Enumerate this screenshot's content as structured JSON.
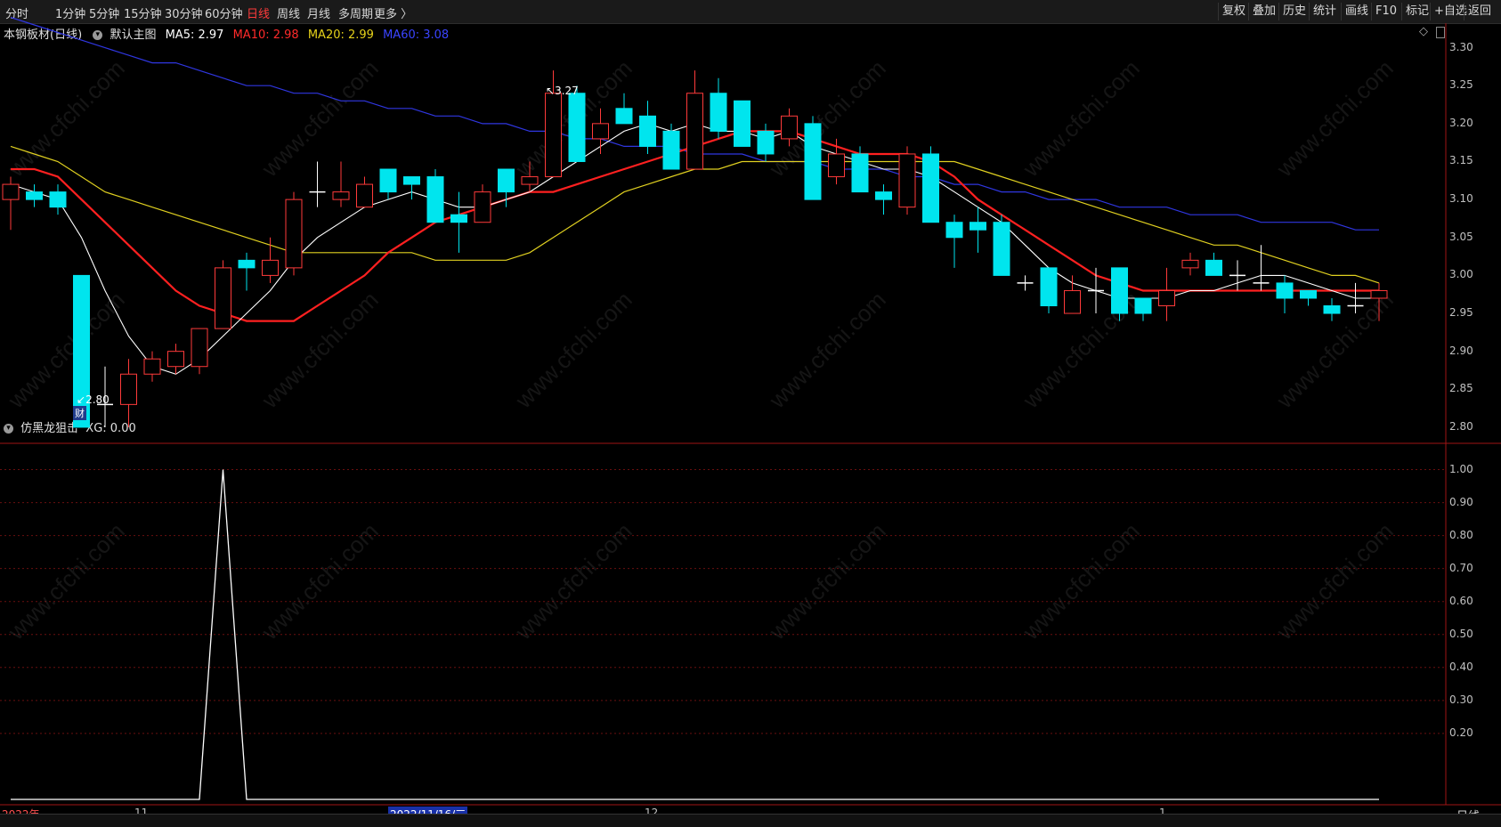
{
  "toolbar": {
    "periods": [
      "分时",
      "1分钟",
      "5分钟",
      "15分钟",
      "30分钟",
      "60分钟",
      "日线",
      "周线",
      "月线",
      "多周期",
      "更多 〉"
    ],
    "active_period": "日线",
    "right_buttons": [
      "复权",
      "叠加",
      "历史",
      "统计",
      "画线",
      "F10",
      "标记",
      "+自选",
      "返回"
    ]
  },
  "main": {
    "stock_name": "本钢板材(日线)",
    "chart_label": "默认主图",
    "ma5": "MA5: 2.97",
    "ma10": "MA10: 2.98",
    "ma20": "MA20: 2.99",
    "ma60": "MA60: 3.08",
    "high_label": "3.27",
    "low_label": "2.80",
    "cai_badge": "财",
    "y_ticks": [
      "3.30",
      "3.25",
      "3.20",
      "3.15",
      "3.10",
      "3.05",
      "3.00",
      "2.95",
      "2.90",
      "2.85",
      "2.80"
    ]
  },
  "sub": {
    "indicator_name": "仿黑龙狙击",
    "xg_value": "XG: 0.00",
    "y_ticks": [
      "1.00",
      "0.90",
      "0.80",
      "0.70",
      "0.60",
      "0.50",
      "0.40",
      "0.30",
      "0.20"
    ]
  },
  "xaxis": {
    "labels": [
      "2022年",
      "11",
      "12",
      "1"
    ],
    "cursor_date": "2022/11/16/三"
  },
  "side": {
    "daily_label": "日线"
  },
  "watermark": "www.cfchi.com",
  "colors": {
    "up": "#ff3a3a",
    "down": "#00e5ee",
    "ma5": "#ffffff",
    "ma10": "#ff2020",
    "ma20": "#e0d020",
    "ma60": "#2f36e0",
    "grid": "#6a0f0f"
  },
  "chart_data": [
    {
      "type": "candlestick",
      "ylim": [
        2.78,
        3.33
      ],
      "candles": [
        {
          "o": 3.1,
          "c": 3.12,
          "h": 3.13,
          "l": 3.06
        },
        {
          "o": 3.11,
          "c": 3.1,
          "h": 3.12,
          "l": 3.09
        },
        {
          "o": 3.11,
          "c": 3.09,
          "h": 3.12,
          "l": 3.08
        },
        {
          "o": 3.0,
          "c": 2.8,
          "h": 3.0,
          "l": 2.8
        },
        {
          "o": 2.83,
          "c": 2.83,
          "h": 2.88,
          "l": 2.8
        },
        {
          "o": 2.83,
          "c": 2.87,
          "h": 2.89,
          "l": 2.8
        },
        {
          "o": 2.87,
          "c": 2.89,
          "h": 2.9,
          "l": 2.86
        },
        {
          "o": 2.88,
          "c": 2.9,
          "h": 2.91,
          "l": 2.87
        },
        {
          "o": 2.88,
          "c": 2.93,
          "h": 2.93,
          "l": 2.87
        },
        {
          "o": 2.93,
          "c": 3.01,
          "h": 3.02,
          "l": 2.93
        },
        {
          "o": 3.02,
          "c": 3.01,
          "h": 3.03,
          "l": 2.98
        },
        {
          "o": 3.0,
          "c": 3.02,
          "h": 3.05,
          "l": 2.99
        },
        {
          "o": 3.01,
          "c": 3.1,
          "h": 3.11,
          "l": 3.0
        },
        {
          "o": 3.11,
          "c": 3.11,
          "h": 3.15,
          "l": 3.09
        },
        {
          "o": 3.1,
          "c": 3.11,
          "h": 3.15,
          "l": 3.09
        },
        {
          "o": 3.09,
          "c": 3.12,
          "h": 3.13,
          "l": 3.09
        },
        {
          "o": 3.14,
          "c": 3.11,
          "h": 3.14,
          "l": 3.1
        },
        {
          "o": 3.13,
          "c": 3.12,
          "h": 3.13,
          "l": 3.1
        },
        {
          "o": 3.13,
          "c": 3.07,
          "h": 3.14,
          "l": 3.07
        },
        {
          "o": 3.08,
          "c": 3.07,
          "h": 3.11,
          "l": 3.03
        },
        {
          "o": 3.07,
          "c": 3.11,
          "h": 3.12,
          "l": 3.07
        },
        {
          "o": 3.14,
          "c": 3.11,
          "h": 3.14,
          "l": 3.09
        },
        {
          "o": 3.12,
          "c": 3.13,
          "h": 3.15,
          "l": 3.11
        },
        {
          "o": 3.13,
          "c": 3.24,
          "h": 3.27,
          "l": 3.13
        },
        {
          "o": 3.24,
          "c": 3.15,
          "h": 3.25,
          "l": 3.15
        },
        {
          "o": 3.18,
          "c": 3.2,
          "h": 3.22,
          "l": 3.16
        },
        {
          "o": 3.22,
          "c": 3.2,
          "h": 3.24,
          "l": 3.2
        },
        {
          "o": 3.21,
          "c": 3.17,
          "h": 3.23,
          "l": 3.16
        },
        {
          "o": 3.19,
          "c": 3.14,
          "h": 3.2,
          "l": 3.14
        },
        {
          "o": 3.14,
          "c": 3.24,
          "h": 3.27,
          "l": 3.14
        },
        {
          "o": 3.24,
          "c": 3.19,
          "h": 3.26,
          "l": 3.18
        },
        {
          "o": 3.23,
          "c": 3.17,
          "h": 3.23,
          "l": 3.17
        },
        {
          "o": 3.19,
          "c": 3.16,
          "h": 3.2,
          "l": 3.15
        },
        {
          "o": 3.18,
          "c": 3.21,
          "h": 3.22,
          "l": 3.17
        },
        {
          "o": 3.2,
          "c": 3.1,
          "h": 3.21,
          "l": 3.1
        },
        {
          "o": 3.13,
          "c": 3.16,
          "h": 3.18,
          "l": 3.12
        },
        {
          "o": 3.16,
          "c": 3.11,
          "h": 3.17,
          "l": 3.11
        },
        {
          "o": 3.11,
          "c": 3.1,
          "h": 3.12,
          "l": 3.08
        },
        {
          "o": 3.09,
          "c": 3.16,
          "h": 3.17,
          "l": 3.08
        },
        {
          "o": 3.16,
          "c": 3.07,
          "h": 3.17,
          "l": 3.07
        },
        {
          "o": 3.07,
          "c": 3.05,
          "h": 3.08,
          "l": 3.01
        },
        {
          "o": 3.07,
          "c": 3.06,
          "h": 3.09,
          "l": 3.03
        },
        {
          "o": 3.07,
          "c": 3.0,
          "h": 3.08,
          "l": 3.0
        },
        {
          "o": 2.99,
          "c": 2.99,
          "h": 3.0,
          "l": 2.98
        },
        {
          "o": 3.01,
          "c": 2.96,
          "h": 3.01,
          "l": 2.95
        },
        {
          "o": 2.95,
          "c": 2.98,
          "h": 3.0,
          "l": 2.95
        },
        {
          "o": 2.98,
          "c": 2.98,
          "h": 3.01,
          "l": 2.95
        },
        {
          "o": 3.01,
          "c": 2.95,
          "h": 3.01,
          "l": 2.94
        },
        {
          "o": 2.97,
          "c": 2.95,
          "h": 2.97,
          "l": 2.94
        },
        {
          "o": 2.96,
          "c": 2.98,
          "h": 3.01,
          "l": 2.94
        },
        {
          "o": 3.01,
          "c": 3.02,
          "h": 3.03,
          "l": 3.0
        },
        {
          "o": 3.02,
          "c": 3.0,
          "h": 3.03,
          "l": 3.0
        },
        {
          "o": 3.0,
          "c": 3.0,
          "h": 3.02,
          "l": 2.98
        },
        {
          "o": 2.99,
          "c": 2.99,
          "h": 3.04,
          "l": 2.98
        },
        {
          "o": 2.99,
          "c": 2.97,
          "h": 3.0,
          "l": 2.95
        },
        {
          "o": 2.98,
          "c": 2.97,
          "h": 2.98,
          "l": 2.96
        },
        {
          "o": 2.96,
          "c": 2.95,
          "h": 2.97,
          "l": 2.94
        },
        {
          "o": 2.96,
          "c": 2.96,
          "h": 2.99,
          "l": 2.95
        },
        {
          "o": 2.97,
          "c": 2.98,
          "h": 2.99,
          "l": 2.94
        }
      ],
      "ma5": [
        3.12,
        3.11,
        3.1,
        3.05,
        2.98,
        2.92,
        2.88,
        2.87,
        2.89,
        2.92,
        2.95,
        2.98,
        3.02,
        3.05,
        3.07,
        3.09,
        3.1,
        3.11,
        3.1,
        3.09,
        3.09,
        3.1,
        3.11,
        3.13,
        3.15,
        3.17,
        3.19,
        3.2,
        3.19,
        3.2,
        3.19,
        3.19,
        3.18,
        3.19,
        3.17,
        3.16,
        3.15,
        3.14,
        3.14,
        3.13,
        3.11,
        3.09,
        3.07,
        3.04,
        3.01,
        2.99,
        2.98,
        2.97,
        2.97,
        2.97,
        2.98,
        2.98,
        2.99,
        3.0,
        3.0,
        2.99,
        2.98,
        2.97,
        2.97
      ],
      "ma10": [
        3.14,
        3.14,
        3.13,
        3.1,
        3.07,
        3.04,
        3.01,
        2.98,
        2.96,
        2.95,
        2.94,
        2.94,
        2.94,
        2.96,
        2.98,
        3.0,
        3.03,
        3.05,
        3.07,
        3.08,
        3.09,
        3.1,
        3.11,
        3.11,
        3.12,
        3.13,
        3.14,
        3.15,
        3.16,
        3.17,
        3.18,
        3.19,
        3.19,
        3.19,
        3.18,
        3.17,
        3.16,
        3.16,
        3.16,
        3.15,
        3.13,
        3.1,
        3.08,
        3.06,
        3.04,
        3.02,
        3.0,
        2.99,
        2.98,
        2.98,
        2.98,
        2.98,
        2.98,
        2.98,
        2.98,
        2.98,
        2.98,
        2.98,
        2.98
      ],
      "ma20": [
        3.17,
        3.16,
        3.15,
        3.13,
        3.11,
        3.1,
        3.09,
        3.08,
        3.07,
        3.06,
        3.05,
        3.04,
        3.03,
        3.03,
        3.03,
        3.03,
        3.03,
        3.03,
        3.02,
        3.02,
        3.02,
        3.02,
        3.03,
        3.05,
        3.07,
        3.09,
        3.11,
        3.12,
        3.13,
        3.14,
        3.14,
        3.15,
        3.15,
        3.15,
        3.15,
        3.15,
        3.15,
        3.15,
        3.15,
        3.15,
        3.15,
        3.14,
        3.13,
        3.12,
        3.11,
        3.1,
        3.09,
        3.08,
        3.07,
        3.06,
        3.05,
        3.04,
        3.04,
        3.03,
        3.02,
        3.01,
        3.0,
        3.0,
        2.99
      ],
      "ma60": [
        3.34,
        3.33,
        3.32,
        3.31,
        3.3,
        3.29,
        3.28,
        3.28,
        3.27,
        3.26,
        3.25,
        3.25,
        3.24,
        3.24,
        3.23,
        3.23,
        3.22,
        3.22,
        3.21,
        3.21,
        3.2,
        3.2,
        3.19,
        3.19,
        3.18,
        3.18,
        3.17,
        3.17,
        3.17,
        3.16,
        3.16,
        3.16,
        3.15,
        3.15,
        3.15,
        3.14,
        3.14,
        3.14,
        3.13,
        3.13,
        3.12,
        3.12,
        3.11,
        3.11,
        3.1,
        3.1,
        3.1,
        3.09,
        3.09,
        3.09,
        3.08,
        3.08,
        3.08,
        3.07,
        3.07,
        3.07,
        3.07,
        3.06,
        3.06
      ]
    },
    {
      "type": "line",
      "ylim": [
        0,
        1.05
      ],
      "series": [
        {
          "values": [
            0,
            0,
            0,
            0,
            0,
            0,
            0,
            0,
            0,
            1,
            0,
            0,
            0,
            0,
            0,
            0,
            0,
            0,
            0,
            0,
            0,
            0,
            0,
            0,
            0,
            0,
            0,
            0,
            0,
            0,
            0,
            0,
            0,
            0,
            0,
            0,
            0,
            0,
            0,
            0,
            0,
            0,
            0,
            0,
            0,
            0,
            0,
            0,
            0,
            0,
            0,
            0,
            0,
            0,
            0,
            0,
            0,
            0,
            0
          ]
        }
      ]
    }
  ]
}
